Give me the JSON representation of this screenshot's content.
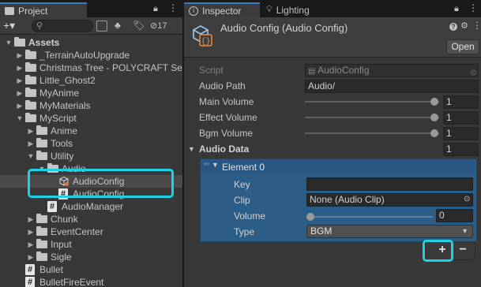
{
  "project": {
    "tab_label": "Project",
    "search_placeholder": "",
    "hidden_count": "17",
    "tree": [
      {
        "label": "Assets",
        "type": "folder",
        "expanded": true,
        "bold": true
      },
      {
        "label": "_TerrainAutoUpgrade",
        "type": "folder"
      },
      {
        "label": "Christmas Tree - POLYCRAFT Se",
        "type": "folder"
      },
      {
        "label": "Little_Ghost2",
        "type": "folder"
      },
      {
        "label": "MyAnime",
        "type": "folder"
      },
      {
        "label": "MyMaterials",
        "type": "folder"
      },
      {
        "label": "MyScript",
        "type": "folder",
        "expanded": true
      },
      {
        "label": "Anime",
        "type": "folder"
      },
      {
        "label": "Tools",
        "type": "folder"
      },
      {
        "label": "Utility",
        "type": "folder",
        "expanded": true
      },
      {
        "label": "Audio",
        "type": "folder",
        "expanded": true
      },
      {
        "label": "AudioConfig",
        "type": "scriptable-object",
        "selected": true
      },
      {
        "label": "AudioConfig",
        "type": "script"
      },
      {
        "label": "AudioManager",
        "type": "script"
      },
      {
        "label": "Chunk",
        "type": "folder"
      },
      {
        "label": "EventCenter",
        "type": "folder"
      },
      {
        "label": "Input",
        "type": "folder"
      },
      {
        "label": "Sigle",
        "type": "folder"
      },
      {
        "label": "Bullet",
        "type": "script"
      },
      {
        "label": "BulletFireEvent",
        "type": "script"
      }
    ]
  },
  "inspector": {
    "tab_label": "Inspector",
    "lighting_tab_label": "Lighting",
    "title": "Audio Config (Audio Config)",
    "open_button": "Open",
    "script_label": "Script",
    "script_value": "AudioConfig",
    "audio_path_label": "Audio Path",
    "audio_path_value": "Audio/",
    "main_volume_label": "Main Volume",
    "main_volume_value": "1",
    "effect_volume_label": "Effect Volume",
    "effect_volume_value": "1",
    "bgm_volume_label": "Bgm Volume",
    "bgm_volume_value": "1",
    "audio_data_label": "Audio Data",
    "audio_data_count": "1",
    "element": {
      "header": "Element 0",
      "key_label": "Key",
      "key_value": "",
      "clip_label": "Clip",
      "clip_value": "None (Audio Clip)",
      "volume_label": "Volume",
      "volume_value": "0",
      "type_label": "Type",
      "type_value": "BGM"
    },
    "add_button": "+",
    "remove_button": "−"
  },
  "colors": {
    "accent_highlight": "#1dd3e3",
    "list_selection": "#2c5d87",
    "tab_accent": "#3a79bb"
  }
}
